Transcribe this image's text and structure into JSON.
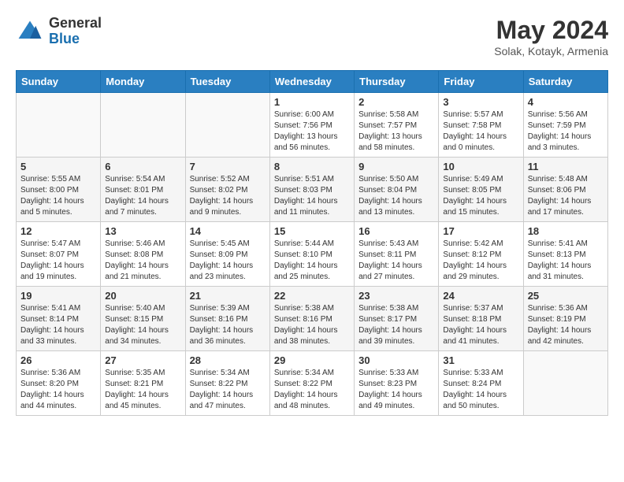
{
  "header": {
    "logo_general": "General",
    "logo_blue": "Blue",
    "title": "May 2024",
    "location": "Solak, Kotayk, Armenia"
  },
  "days_of_week": [
    "Sunday",
    "Monday",
    "Tuesday",
    "Wednesday",
    "Thursday",
    "Friday",
    "Saturday"
  ],
  "weeks": [
    [
      {
        "day": "",
        "content": ""
      },
      {
        "day": "",
        "content": ""
      },
      {
        "day": "",
        "content": ""
      },
      {
        "day": "1",
        "content": "Sunrise: 6:00 AM\nSunset: 7:56 PM\nDaylight: 13 hours\nand 56 minutes."
      },
      {
        "day": "2",
        "content": "Sunrise: 5:58 AM\nSunset: 7:57 PM\nDaylight: 13 hours\nand 58 minutes."
      },
      {
        "day": "3",
        "content": "Sunrise: 5:57 AM\nSunset: 7:58 PM\nDaylight: 14 hours\nand 0 minutes."
      },
      {
        "day": "4",
        "content": "Sunrise: 5:56 AM\nSunset: 7:59 PM\nDaylight: 14 hours\nand 3 minutes."
      }
    ],
    [
      {
        "day": "5",
        "content": "Sunrise: 5:55 AM\nSunset: 8:00 PM\nDaylight: 14 hours\nand 5 minutes."
      },
      {
        "day": "6",
        "content": "Sunrise: 5:54 AM\nSunset: 8:01 PM\nDaylight: 14 hours\nand 7 minutes."
      },
      {
        "day": "7",
        "content": "Sunrise: 5:52 AM\nSunset: 8:02 PM\nDaylight: 14 hours\nand 9 minutes."
      },
      {
        "day": "8",
        "content": "Sunrise: 5:51 AM\nSunset: 8:03 PM\nDaylight: 14 hours\nand 11 minutes."
      },
      {
        "day": "9",
        "content": "Sunrise: 5:50 AM\nSunset: 8:04 PM\nDaylight: 14 hours\nand 13 minutes."
      },
      {
        "day": "10",
        "content": "Sunrise: 5:49 AM\nSunset: 8:05 PM\nDaylight: 14 hours\nand 15 minutes."
      },
      {
        "day": "11",
        "content": "Sunrise: 5:48 AM\nSunset: 8:06 PM\nDaylight: 14 hours\nand 17 minutes."
      }
    ],
    [
      {
        "day": "12",
        "content": "Sunrise: 5:47 AM\nSunset: 8:07 PM\nDaylight: 14 hours\nand 19 minutes."
      },
      {
        "day": "13",
        "content": "Sunrise: 5:46 AM\nSunset: 8:08 PM\nDaylight: 14 hours\nand 21 minutes."
      },
      {
        "day": "14",
        "content": "Sunrise: 5:45 AM\nSunset: 8:09 PM\nDaylight: 14 hours\nand 23 minutes."
      },
      {
        "day": "15",
        "content": "Sunrise: 5:44 AM\nSunset: 8:10 PM\nDaylight: 14 hours\nand 25 minutes."
      },
      {
        "day": "16",
        "content": "Sunrise: 5:43 AM\nSunset: 8:11 PM\nDaylight: 14 hours\nand 27 minutes."
      },
      {
        "day": "17",
        "content": "Sunrise: 5:42 AM\nSunset: 8:12 PM\nDaylight: 14 hours\nand 29 minutes."
      },
      {
        "day": "18",
        "content": "Sunrise: 5:41 AM\nSunset: 8:13 PM\nDaylight: 14 hours\nand 31 minutes."
      }
    ],
    [
      {
        "day": "19",
        "content": "Sunrise: 5:41 AM\nSunset: 8:14 PM\nDaylight: 14 hours\nand 33 minutes."
      },
      {
        "day": "20",
        "content": "Sunrise: 5:40 AM\nSunset: 8:15 PM\nDaylight: 14 hours\nand 34 minutes."
      },
      {
        "day": "21",
        "content": "Sunrise: 5:39 AM\nSunset: 8:16 PM\nDaylight: 14 hours\nand 36 minutes."
      },
      {
        "day": "22",
        "content": "Sunrise: 5:38 AM\nSunset: 8:16 PM\nDaylight: 14 hours\nand 38 minutes."
      },
      {
        "day": "23",
        "content": "Sunrise: 5:38 AM\nSunset: 8:17 PM\nDaylight: 14 hours\nand 39 minutes."
      },
      {
        "day": "24",
        "content": "Sunrise: 5:37 AM\nSunset: 8:18 PM\nDaylight: 14 hours\nand 41 minutes."
      },
      {
        "day": "25",
        "content": "Sunrise: 5:36 AM\nSunset: 8:19 PM\nDaylight: 14 hours\nand 42 minutes."
      }
    ],
    [
      {
        "day": "26",
        "content": "Sunrise: 5:36 AM\nSunset: 8:20 PM\nDaylight: 14 hours\nand 44 minutes."
      },
      {
        "day": "27",
        "content": "Sunrise: 5:35 AM\nSunset: 8:21 PM\nDaylight: 14 hours\nand 45 minutes."
      },
      {
        "day": "28",
        "content": "Sunrise: 5:34 AM\nSunset: 8:22 PM\nDaylight: 14 hours\nand 47 minutes."
      },
      {
        "day": "29",
        "content": "Sunrise: 5:34 AM\nSunset: 8:22 PM\nDaylight: 14 hours\nand 48 minutes."
      },
      {
        "day": "30",
        "content": "Sunrise: 5:33 AM\nSunset: 8:23 PM\nDaylight: 14 hours\nand 49 minutes."
      },
      {
        "day": "31",
        "content": "Sunrise: 5:33 AM\nSunset: 8:24 PM\nDaylight: 14 hours\nand 50 minutes."
      },
      {
        "day": "",
        "content": ""
      }
    ]
  ]
}
